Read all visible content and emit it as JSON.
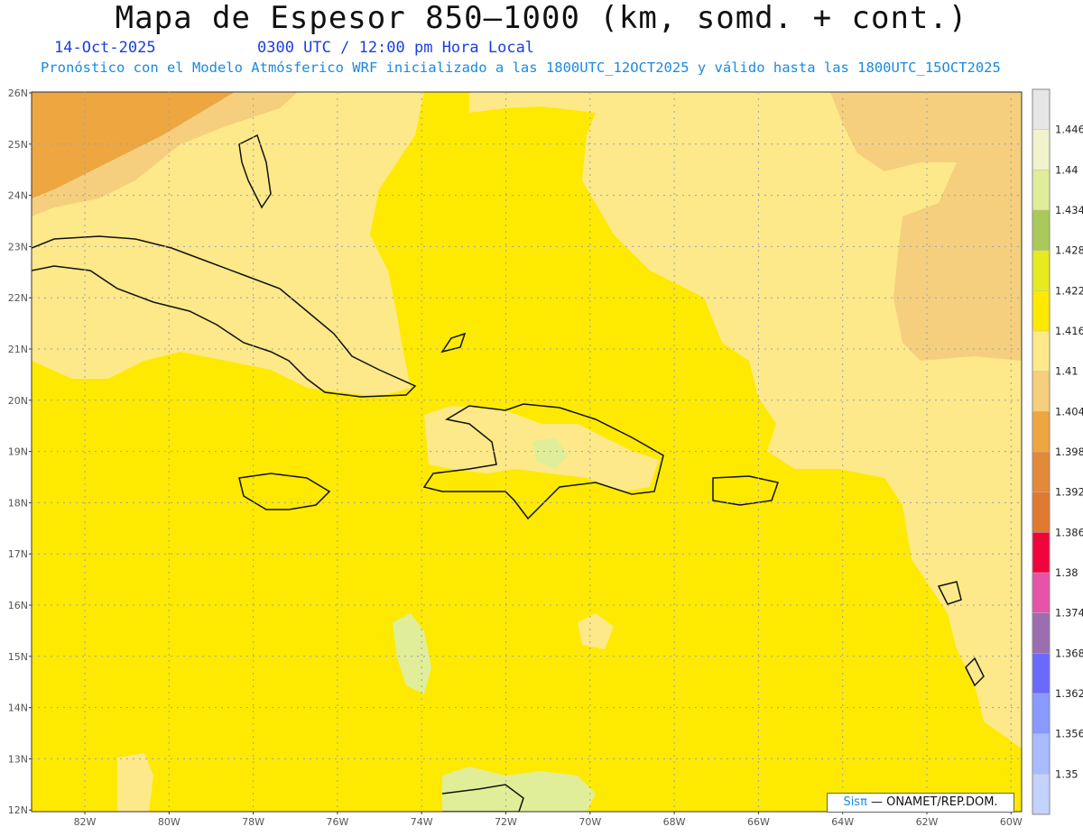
{
  "title": "Mapa de Espesor 850—1000 (km, somd. + cont.)",
  "date": "14-Oct-2025",
  "time_info": "0300 UTC / 12:00 pm Hora Local",
  "forecast_line": "Pronóstico con el Modelo Atmósferico WRF inicializado a las 1800UTC_12OCT2025 y válido hasta las  1800UTC_15OCT2025",
  "lat_labels": [
    "26N",
    "25N",
    "24N",
    "23N",
    "22N",
    "21N",
    "20N",
    "19N",
    "18N",
    "17N",
    "16N",
    "15N",
    "14N",
    "13N",
    "12N"
  ],
  "lon_labels": [
    "82W",
    "80W",
    "78W",
    "76W",
    "74W",
    "72W",
    "70W",
    "68W",
    "66W",
    "64W",
    "62W",
    "60W"
  ],
  "colorbar": {
    "labels": [
      "1.446",
      "1.44",
      "1.434",
      "1.428",
      "1.422",
      "1.416",
      "1.41",
      "1.404",
      "1.398",
      "1.392",
      "1.386",
      "1.38",
      "1.374",
      "1.368",
      "1.362",
      "1.356",
      "1.35"
    ],
    "colors": [
      "#e6e6e6",
      "#f0f3cc",
      "#e0ee9a",
      "#a9c95a",
      "#e6ea1e",
      "#fdea00",
      "#fde989",
      "#f5cf7d",
      "#eda640",
      "#e3893a",
      "#e07a30",
      "#f0043c",
      "#e653a9",
      "#9c6eb0",
      "#6a6aff",
      "#8a9aff",
      "#a8bcff",
      "#c4d2ff"
    ]
  },
  "credit": {
    "brand": "Sisπ",
    "text": " — ONAMET/REP.DOM."
  },
  "colors": {
    "field_main": "#fdea00",
    "field_light": "#fde989",
    "field_tan": "#f5cf7d",
    "field_orange": "#eda640",
    "field_green": "#e0ee9a"
  }
}
